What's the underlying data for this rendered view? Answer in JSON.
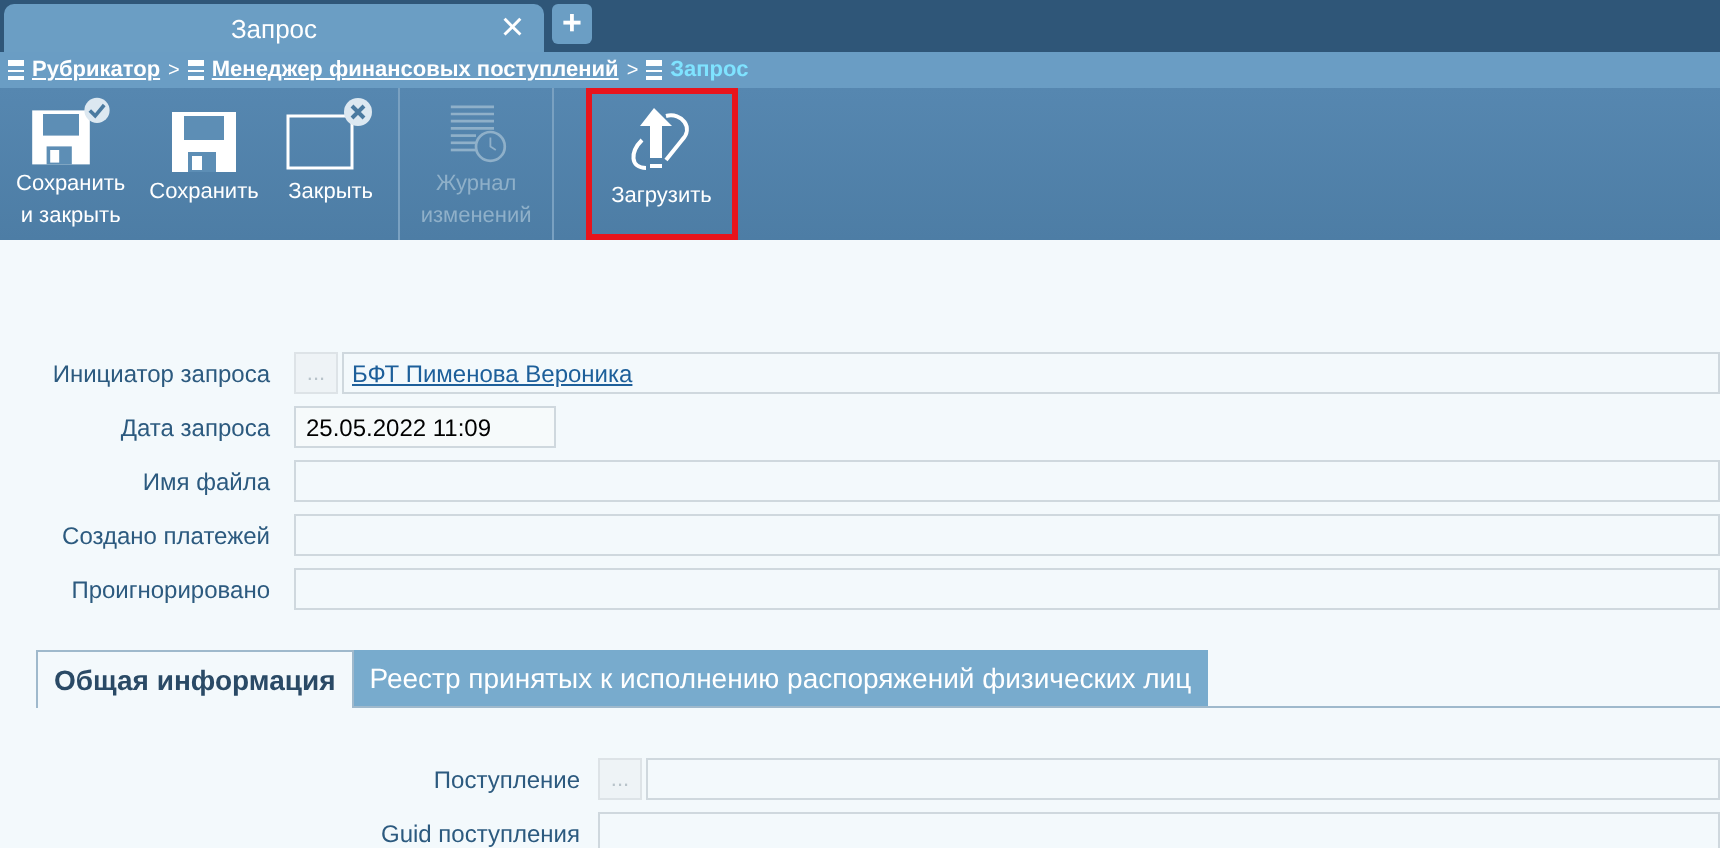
{
  "window_tabs": [
    {
      "label": "Запрос",
      "selected": true,
      "close": "×"
    }
  ],
  "new_tab": "+",
  "breadcrumbs": [
    {
      "label": "Рубрикатор",
      "link": true
    },
    {
      "label": "Менеджер финансовых поступлений",
      "link": true
    },
    {
      "label": "Запрос",
      "link": false
    }
  ],
  "breadcrumb_separator": ">",
  "toolbar_groups": [
    {
      "buttons": [
        {
          "label": "Сохранить\nи закрыть",
          "kind": "save-close",
          "disabled": false,
          "highlighted": false
        },
        {
          "label": "Сохранить",
          "kind": "save",
          "disabled": false,
          "highlighted": false
        },
        {
          "label": "Закрыть",
          "kind": "close",
          "disabled": false,
          "highlighted": false
        }
      ]
    },
    {
      "buttons": [
        {
          "label": "Журнал\nизменений",
          "kind": "journal",
          "disabled": true,
          "highlighted": false
        }
      ]
    },
    {
      "buttons": [
        {
          "label": "Загрузить",
          "kind": "upload",
          "disabled": false,
          "highlighted": true
        }
      ]
    }
  ],
  "form": [
    {
      "label": "Инициатор запроса",
      "kind": "lookup",
      "value": "БФТ Пименова Вероника",
      "picker": "..."
    },
    {
      "label": "Дата запроса",
      "kind": "short",
      "value": "25.05.2022 11:09"
    },
    {
      "label": "Имя файла",
      "kind": "text"
    },
    {
      "label": "Создано платежей",
      "kind": "text"
    },
    {
      "label": "Проигнорировано",
      "kind": "text"
    }
  ],
  "section_tabs": [
    {
      "label": "Общая информация",
      "selected": true
    },
    {
      "label": "Реестр принятых к исполнению распоряжений физических лиц",
      "selected": false
    }
  ],
  "section_form": [
    {
      "label": "Поступление",
      "kind": "lookup",
      "picker": "..."
    },
    {
      "label": "Guid поступления",
      "kind": "text"
    }
  ]
}
